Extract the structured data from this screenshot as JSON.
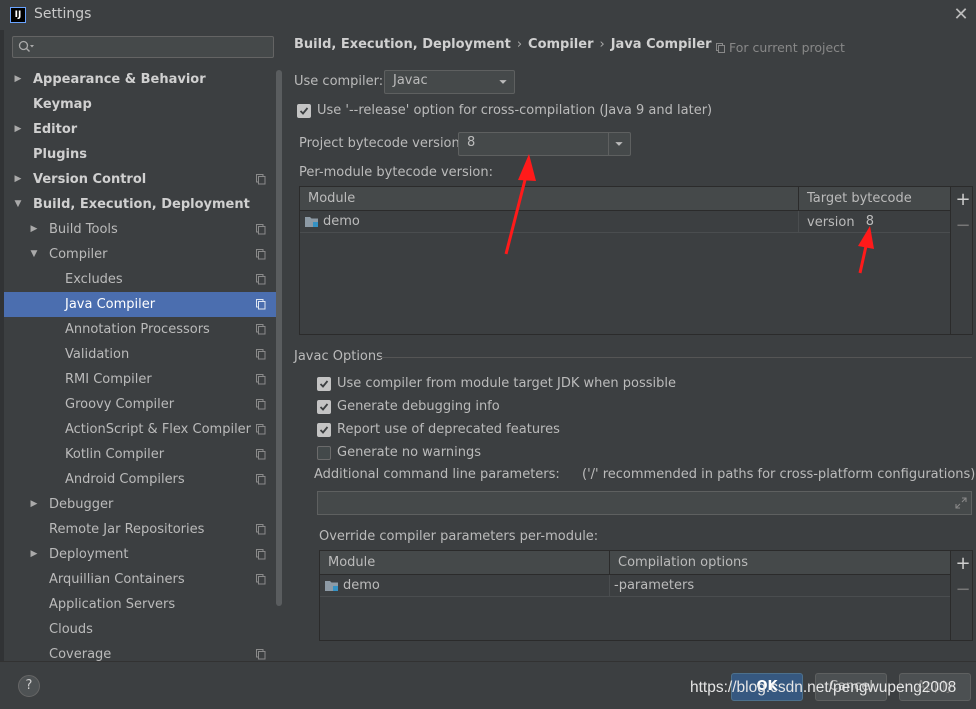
{
  "window": {
    "title": "Settings",
    "app_icon": "intellij-icon",
    "close_icon": "close-icon"
  },
  "search": {
    "placeholder": "",
    "icon": "search-icon"
  },
  "tree": [
    {
      "label": "Appearance & Behavior",
      "level": 0,
      "bold": true,
      "expandable": true,
      "expanded": false,
      "project_icon": false
    },
    {
      "label": "Keymap",
      "level": 0,
      "bold": true,
      "expandable": false,
      "project_icon": false
    },
    {
      "label": "Editor",
      "level": 0,
      "bold": true,
      "expandable": true,
      "expanded": false,
      "project_icon": false
    },
    {
      "label": "Plugins",
      "level": 0,
      "bold": true,
      "expandable": false,
      "project_icon": false
    },
    {
      "label": "Version Control",
      "level": 0,
      "bold": true,
      "expandable": true,
      "expanded": false,
      "project_icon": true
    },
    {
      "label": "Build, Execution, Deployment",
      "level": 0,
      "bold": true,
      "expandable": true,
      "expanded": true,
      "project_icon": false
    },
    {
      "label": "Build Tools",
      "level": 1,
      "bold": false,
      "expandable": true,
      "expanded": false,
      "project_icon": true
    },
    {
      "label": "Compiler",
      "level": 1,
      "bold": false,
      "expandable": true,
      "expanded": true,
      "project_icon": true
    },
    {
      "label": "Excludes",
      "level": 2,
      "bold": false,
      "expandable": false,
      "project_icon": true
    },
    {
      "label": "Java Compiler",
      "level": 2,
      "bold": false,
      "expandable": false,
      "project_icon": true,
      "selected": true
    },
    {
      "label": "Annotation Processors",
      "level": 2,
      "bold": false,
      "expandable": false,
      "project_icon": true
    },
    {
      "label": "Validation",
      "level": 2,
      "bold": false,
      "expandable": false,
      "project_icon": true
    },
    {
      "label": "RMI Compiler",
      "level": 2,
      "bold": false,
      "expandable": false,
      "project_icon": true
    },
    {
      "label": "Groovy Compiler",
      "level": 2,
      "bold": false,
      "expandable": false,
      "project_icon": true
    },
    {
      "label": "ActionScript & Flex Compiler",
      "level": 2,
      "bold": false,
      "expandable": false,
      "project_icon": true
    },
    {
      "label": "Kotlin Compiler",
      "level": 2,
      "bold": false,
      "expandable": false,
      "project_icon": true
    },
    {
      "label": "Android Compilers",
      "level": 2,
      "bold": false,
      "expandable": false,
      "project_icon": true
    },
    {
      "label": "Debugger",
      "level": 1,
      "bold": false,
      "expandable": true,
      "expanded": false,
      "project_icon": false
    },
    {
      "label": "Remote Jar Repositories",
      "level": 1,
      "bold": false,
      "expandable": false,
      "project_icon": true
    },
    {
      "label": "Deployment",
      "level": 1,
      "bold": false,
      "expandable": true,
      "expanded": false,
      "project_icon": true
    },
    {
      "label": "Arquillian Containers",
      "level": 1,
      "bold": false,
      "expandable": false,
      "project_icon": true
    },
    {
      "label": "Application Servers",
      "level": 1,
      "bold": false,
      "expandable": false,
      "project_icon": false
    },
    {
      "label": "Clouds",
      "level": 1,
      "bold": false,
      "expandable": false,
      "project_icon": false
    },
    {
      "label": "Coverage",
      "level": 1,
      "bold": false,
      "expandable": false,
      "project_icon": true
    }
  ],
  "breadcrumb": {
    "items": [
      "Build, Execution, Deployment",
      "Compiler",
      "Java Compiler"
    ],
    "separator": "›"
  },
  "for_project": "For current project",
  "use_compiler": {
    "label": "Use compiler:",
    "value": "Javac"
  },
  "release_option": {
    "label": "Use '--release' option for cross-compilation (Java 9 and later)",
    "checked": true
  },
  "project_bytecode": {
    "label": "Project bytecode version:",
    "value": "8"
  },
  "per_module": {
    "label": "Per-module bytecode version:",
    "columns": [
      "Module",
      "Target bytecode version"
    ],
    "rows": [
      {
        "module": "demo",
        "target": "8"
      }
    ]
  },
  "javac_options": {
    "section_label": "Javac Options",
    "checkboxes": [
      {
        "label": "Use compiler from module target JDK when possible",
        "checked": true
      },
      {
        "label": "Generate debugging info",
        "checked": true
      },
      {
        "label": "Report use of deprecated features",
        "checked": true
      },
      {
        "label": "Generate no warnings",
        "checked": false
      }
    ],
    "cmdline_label": "Additional command line parameters:",
    "cmdline_hint": "('/' recommended in paths for cross-platform configurations)",
    "cmdline_value": ""
  },
  "override": {
    "label": "Override compiler parameters per-module:",
    "columns": [
      "Module",
      "Compilation options"
    ],
    "rows": [
      {
        "module": "demo",
        "options": "-parameters"
      }
    ]
  },
  "buttons": {
    "ok": "OK",
    "cancel": "Cancel",
    "apply": "Apply",
    "help": "?"
  },
  "watermark": "https://blog.csdn.net/pengwupeng2008",
  "colors": {
    "background": "#3c3f41",
    "selection": "#4b6eaf",
    "ok_button": "#365880",
    "annotation_arrow": "#ff1a1a"
  }
}
